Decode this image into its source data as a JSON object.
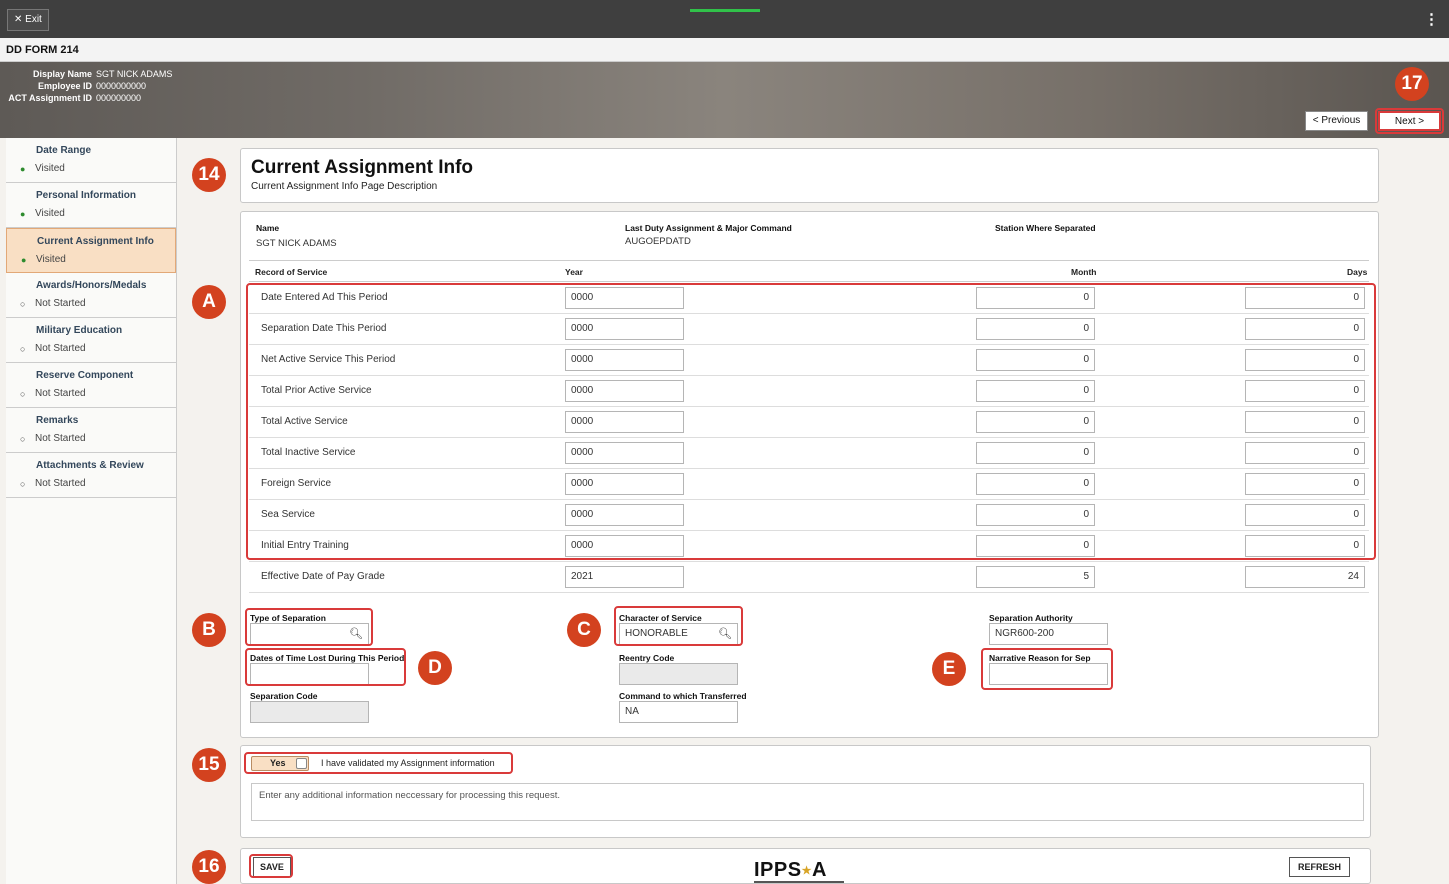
{
  "topbar": {
    "exit_label": "✕ Exit",
    "menu_icon": "⋮"
  },
  "form_title": "DD FORM 214",
  "employee": {
    "display_name_label": "Display Name",
    "display_name": "SGT NICK ADAMS",
    "employee_id_label": "Employee ID",
    "employee_id": "0000000000",
    "assignment_id_label": "ACT Assignment ID",
    "assignment_id": "000000000"
  },
  "nav": {
    "previous": "< Previous",
    "next": "Next >"
  },
  "sidebar": {
    "items": [
      {
        "title": "Date Range",
        "status": "Visited"
      },
      {
        "title": "Personal Information",
        "status": "Visited"
      },
      {
        "title": "Current Assignment Info",
        "status": "Visited"
      },
      {
        "title": "Awards/Honors/Medals",
        "status": "Not Started"
      },
      {
        "title": "Military Education",
        "status": "Not Started"
      },
      {
        "title": "Reserve Component",
        "status": "Not Started"
      },
      {
        "title": "Remarks",
        "status": "Not Started"
      },
      {
        "title": "Attachments & Review",
        "status": "Not Started"
      }
    ]
  },
  "page": {
    "title": "Current Assignment Info",
    "description": "Current Assignment Info Page Description"
  },
  "assignment": {
    "name_label": "Name",
    "name": "SGT NICK ADAMS",
    "duty_label": "Last Duty Assignment & Major Command",
    "duty": "AUGOEPDATD",
    "station_label": "Station Where Separated"
  },
  "service": {
    "headers": {
      "record": "Record of Service",
      "year": "Year",
      "month": "Month",
      "days": "Days"
    },
    "rows": [
      {
        "label": "Date Entered Ad This Period",
        "year": "0000",
        "month": "0",
        "days": "0"
      },
      {
        "label": "Separation Date This Period",
        "year": "0000",
        "month": "0",
        "days": "0"
      },
      {
        "label": "Net Active Service This Period",
        "year": "0000",
        "month": "0",
        "days": "0"
      },
      {
        "label": "Total Prior Active Service",
        "year": "0000",
        "month": "0",
        "days": "0"
      },
      {
        "label": "Total Active Service",
        "year": "0000",
        "month": "0",
        "days": "0"
      },
      {
        "label": "Total Inactive Service",
        "year": "0000",
        "month": "0",
        "days": "0"
      },
      {
        "label": "Foreign Service",
        "year": "0000",
        "month": "0",
        "days": "0"
      },
      {
        "label": "Sea Service",
        "year": "0000",
        "month": "0",
        "days": "0"
      },
      {
        "label": "Initial Entry Training",
        "year": "0000",
        "month": "0",
        "days": "0"
      },
      {
        "label": "Effective Date of Pay Grade",
        "year": "2021",
        "month": "5",
        "days": "24"
      }
    ]
  },
  "fields": {
    "type_sep_label": "Type of Separation",
    "type_sep_value": "",
    "time_lost_label": "Dates of Time Lost During This Period",
    "time_lost_value": "",
    "sep_code_label": "Separation Code",
    "sep_code_value": "",
    "character_label": "Character of Service",
    "character_value": "HONORABLE",
    "reentry_label": "Reentry Code",
    "reentry_value": "",
    "command_label": "Command to which Transferred",
    "command_value": "NA",
    "authority_label": "Separation Authority",
    "authority_value": "NGR600-200",
    "narrative_label": "Narrative Reason for Sep",
    "narrative_value": ""
  },
  "validation": {
    "toggle_label": "Yes",
    "checkbox_text": "I have validated my Assignment information",
    "textarea_placeholder": "Enter any additional information neccessary for processing this request."
  },
  "footer": {
    "save": "SAVE",
    "refresh": "REFRESH",
    "logo": "IPPS",
    "logo_tail": "A"
  },
  "callouts": {
    "c14": "14",
    "c15": "15",
    "c16": "16",
    "c17": "17",
    "cA": "A",
    "cB": "B",
    "cC": "C",
    "cD": "D",
    "cE": "E"
  },
  "colors": {
    "accent": "#d3421f",
    "highlight": "#d93a3a",
    "active_nav": "#f9dfc4",
    "visited": "#2e8b2e"
  }
}
